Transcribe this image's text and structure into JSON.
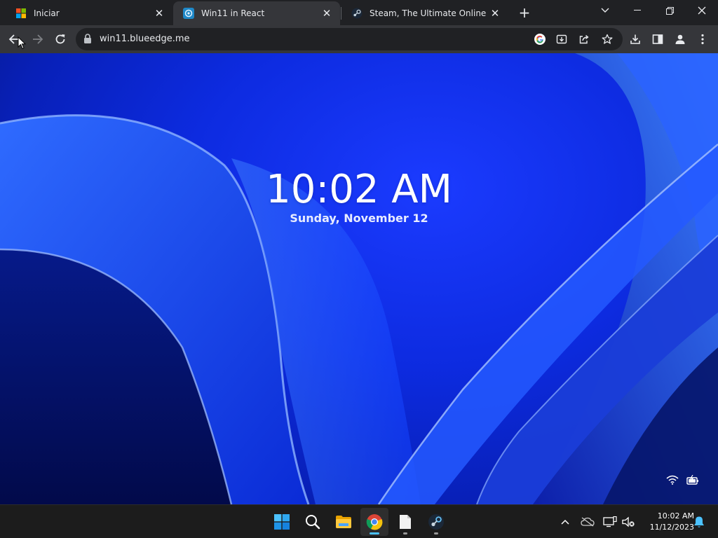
{
  "browser": {
    "tabs": [
      {
        "title": "Iniciar",
        "favicon": "windows-logo-icon",
        "active": false
      },
      {
        "title": "Win11 in React",
        "favicon": "win11-react-icon",
        "active": true
      },
      {
        "title": "Steam, The Ultimate Online Gam",
        "favicon": "steam-icon",
        "active": false
      }
    ],
    "url": "win11.blueedge.me"
  },
  "lockscreen": {
    "time": "10:02 AM",
    "date": "Sunday, November 12"
  },
  "taskbar": {
    "clock_time": "10:02 AM",
    "clock_date": "11/12/2023"
  },
  "colors": {
    "accent": "#1a73e8",
    "wallpaper": "#0d2be0"
  }
}
